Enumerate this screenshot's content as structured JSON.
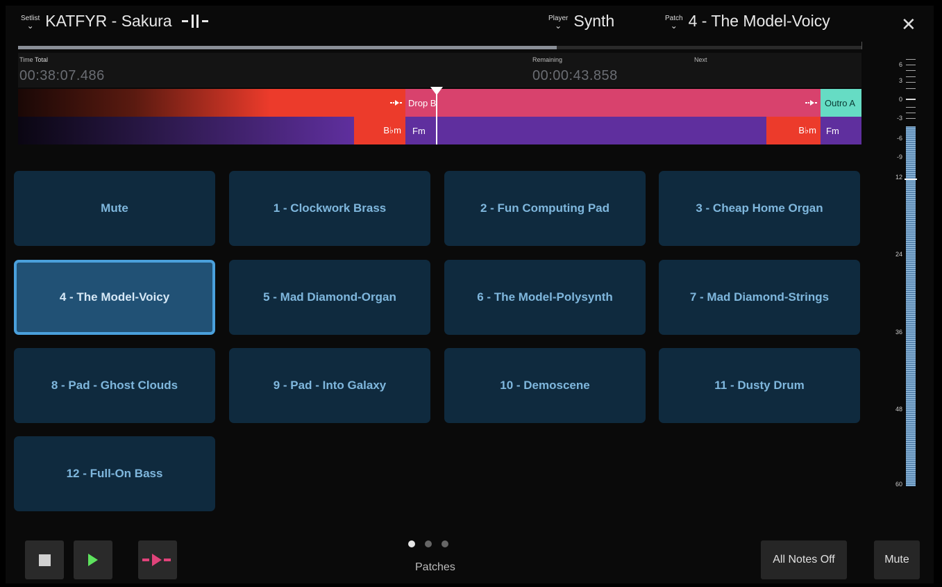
{
  "header": {
    "setlist": {
      "tag": "Setlist",
      "value": "KATFYR - Sakura",
      "icon": "section-marker-icon"
    },
    "player": {
      "tag": "Player",
      "value": "Synth"
    },
    "patch": {
      "tag": "Patch",
      "value": "4 - The Model-Voicy"
    },
    "close": "✕"
  },
  "progress": {
    "fraction": 0.639
  },
  "time": {
    "label_time": "Time",
    "label_total": "Total",
    "total": "00:38:07.486",
    "label_remaining": "Remaining",
    "remaining": "00:00:43.858",
    "label_next": "Next"
  },
  "timeline": {
    "sections": [
      {
        "label": "",
        "color": "#ec3b2b",
        "gradient": true
      },
      {
        "label": "Drop B",
        "color": "#d8426d"
      },
      {
        "label": "Outro A",
        "color": "#66dcc4"
      }
    ],
    "chords": [
      {
        "label": "",
        "color": "#5f2f9e",
        "gradient": true
      },
      {
        "label": "B♭m",
        "color": "#ec3b2b"
      },
      {
        "label": "Fm",
        "color": "#5f2f9e"
      },
      {
        "label": "B♭m",
        "color": "#ec3b2b"
      },
      {
        "label": "Fm",
        "color": "#5f2f9e"
      }
    ],
    "marker_icon": "jump-marker-icon"
  },
  "meter": {
    "labels": [
      "6",
      "3",
      "0",
      "-3",
      "-6",
      "-9",
      "12",
      "24",
      "36",
      "48",
      "60"
    ]
  },
  "patches": [
    "Mute",
    "1 - Clockwork Brass",
    "2 - Fun Computing Pad",
    "3 - Cheap Home Organ",
    "4 - The Model-Voicy",
    "5 - Mad Diamond-Organ",
    "6 - The Model-Polysynth",
    "7 - Mad Diamond-Strings",
    "8 - Pad - Ghost Clouds",
    "9 - Pad - Into Galaxy",
    "10 - Demoscene",
    "11 - Dusty Drum",
    "12 - Full-On Bass"
  ],
  "selected_patch": "4 - The Model-Voicy",
  "bottom": {
    "stop_icon": "stop-icon",
    "play_icon": "play-icon",
    "jump_icon": "jump-next-icon",
    "page_label": "Patches",
    "page_count": 3,
    "page_active": 0,
    "all_notes_off": "All Notes Off",
    "mute": "Mute"
  },
  "colors": {
    "accent": "#4aa0dc",
    "pad_bg": "#0f2a3e",
    "pad_text": "#7fb7dd",
    "play_green": "#5ee35e",
    "jump_pink": "#e0437a"
  }
}
